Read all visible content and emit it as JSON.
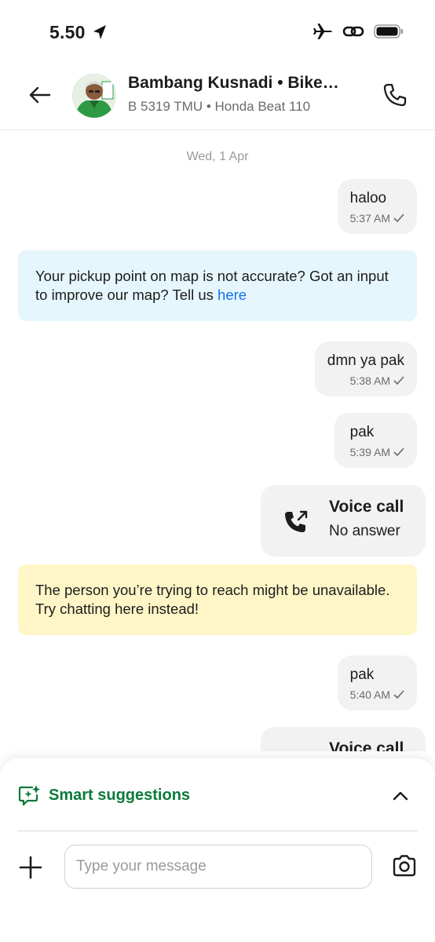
{
  "status_bar": {
    "time": "5.50"
  },
  "header": {
    "contact_name": "Bambang Kusnadi • Bike…",
    "contact_sub": "B 5319 TMU • Honda Beat 110"
  },
  "chat": {
    "date_separator": "Wed, 1 Apr",
    "messages": [
      {
        "text": "haloo",
        "time": "5:37 AM"
      },
      {
        "text": "dmn ya pak",
        "time": "5:38 AM"
      },
      {
        "text": "pak",
        "time": "5:39 AM"
      },
      {
        "text": "pak",
        "time": "5:40 AM"
      }
    ],
    "map_card": {
      "text": "Your pickup point on map is not accurate? Got an input to improve our map? Tell us ",
      "link": "here"
    },
    "voice_calls": [
      {
        "title": "Voice call",
        "status": "No answer"
      },
      {
        "title": "Voice call"
      }
    ],
    "unavailable_card": {
      "text": "The person you’re trying to reach might be unavailable. Try chatting here instead!"
    }
  },
  "bottom": {
    "smart_suggestions_label": "Smart suggestions",
    "input_placeholder": "Type your message"
  },
  "colors": {
    "accent_green": "#0a7a3a",
    "link_blue": "#1473e6",
    "info_blue_bg": "#e6f6fd",
    "info_yellow_bg": "#fff6c7",
    "bubble_bg": "#f2f2f2"
  },
  "icons": {
    "status_location": "location-arrow-icon",
    "status_airplane": "airplane-icon",
    "status_link": "link-icon",
    "status_battery": "battery-icon",
    "back": "arrow-left-icon",
    "call": "phone-icon",
    "voice_call": "phone-outgoing-icon",
    "smart": "sparkle-chat-icon",
    "collapse": "chevron-up-icon",
    "add": "plus-icon",
    "camera": "camera-icon"
  }
}
